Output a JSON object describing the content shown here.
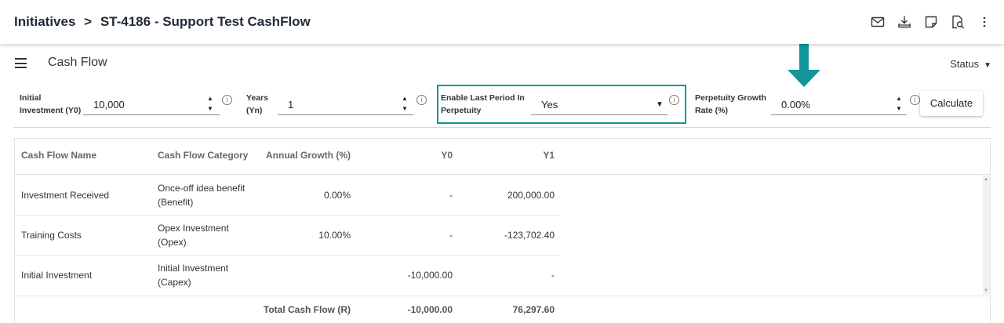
{
  "header": {
    "breadcrumb_root": "Initiatives",
    "breadcrumb_sep": ">",
    "breadcrumb_current": "ST-4186 - Support Test CashFlow",
    "icons": [
      "mail-icon",
      "download-icon",
      "note-icon",
      "document-search-icon",
      "more-vertical-icon"
    ]
  },
  "subbar": {
    "title": "Cash Flow",
    "status_label": "Status",
    "status_caret": "▼"
  },
  "form": {
    "initial_investment": {
      "label_line1": "Initial",
      "label_line2": "Investment (Y0)",
      "value": "10,000"
    },
    "years": {
      "label_line1": "Years",
      "label_line2": "(Yn)",
      "value": "1"
    },
    "perpetuity": {
      "label_line1": "Enable Last Period In",
      "label_line2": "Perpetuity",
      "value": "Yes",
      "caret": "▼"
    },
    "growth_rate": {
      "label_line1": "Perpetuity Growth",
      "label_line2": "Rate (%)",
      "value": "0.00%"
    },
    "spinner_up": "▲",
    "spinner_down": "▼",
    "info_glyph": "i",
    "calculate_label": "Calculate"
  },
  "table": {
    "columns": [
      "Cash Flow Name",
      "Cash Flow Category",
      "Annual Growth (%)",
      "Y0",
      "Y1"
    ],
    "rows": [
      {
        "name": "Investment Received",
        "category_line1": "Once-off idea benefit",
        "category_line2": "(Benefit)",
        "growth": "0.00%",
        "y0": "-",
        "y1": "200,000.00"
      },
      {
        "name": "Training Costs",
        "category_line1": "Opex Investment",
        "category_line2": "(Opex)",
        "growth": "10.00%",
        "y0": "-",
        "y1": "-123,702.40"
      },
      {
        "name": "Initial Investment",
        "category_line1": "Initial Investment",
        "category_line2": "(Capex)",
        "growth": "",
        "y0": "-10,000.00",
        "y1": "-"
      }
    ],
    "total": {
      "label": "Total Cash Flow (R)",
      "y0": "-10,000.00",
      "y1": "76,297.60"
    },
    "scroll_up": "▲",
    "scroll_down": "▼"
  },
  "colors": {
    "accent": "#12969a",
    "header_text": "#1f2a37"
  }
}
